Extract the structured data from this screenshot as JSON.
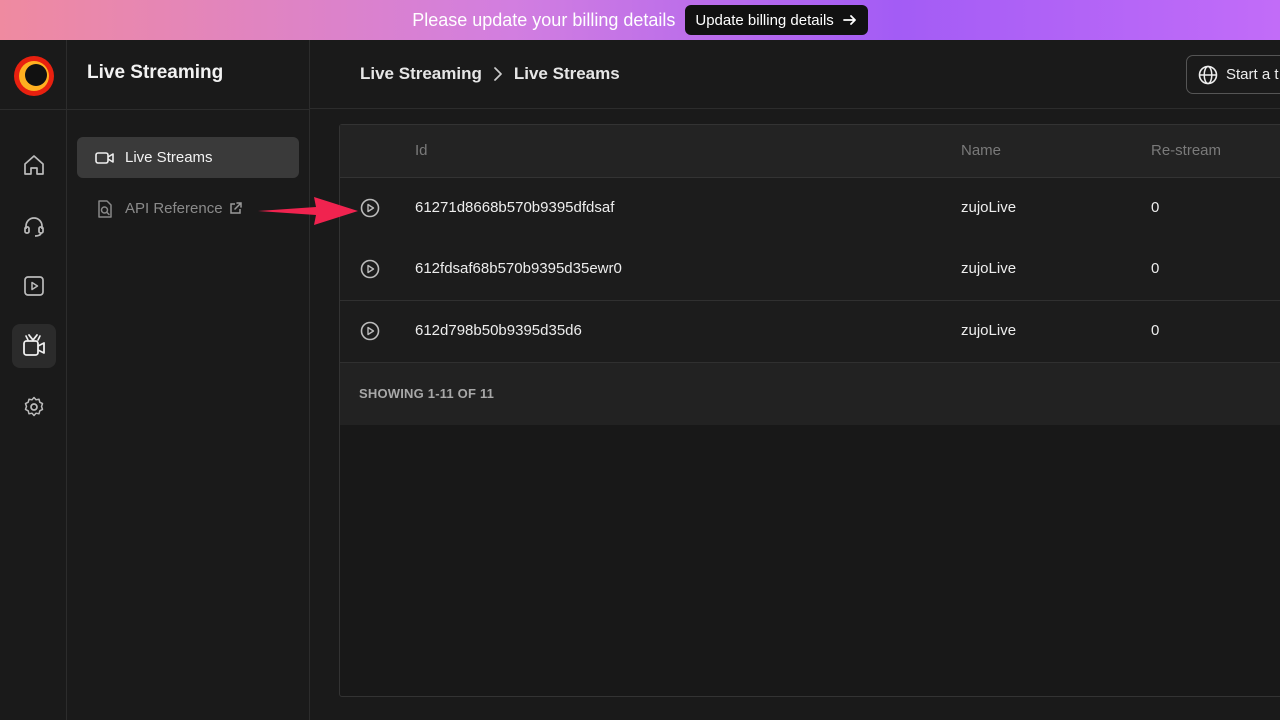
{
  "banner": {
    "message": "Please update your billing details",
    "button_label": "Update billing details"
  },
  "app": {
    "title": "Live Streaming"
  },
  "rail": {
    "items": [
      {
        "icon": "home-icon"
      },
      {
        "icon": "headset-icon"
      },
      {
        "icon": "video-play-icon"
      },
      {
        "icon": "tv-live-icon",
        "active": true
      },
      {
        "icon": "gear-icon"
      }
    ]
  },
  "sidebar": {
    "items": [
      {
        "label": "Live Streams",
        "icon": "video-camera-icon",
        "active": true
      },
      {
        "label": "API Reference",
        "icon": "api-doc-icon",
        "external": true
      }
    ]
  },
  "header": {
    "breadcrumb": [
      "Live Streaming",
      "Live Streams"
    ],
    "start_button_label": "Start a t"
  },
  "table": {
    "columns": [
      "Id",
      "Name",
      "Re-stream"
    ],
    "rows": [
      {
        "id": "61271d8668b570b9395dfdsaf",
        "name": "zujoLive",
        "restream": "0"
      },
      {
        "id": "612fdsaf68b570b9395d35ewr0",
        "name": "zujoLive",
        "restream": "0"
      },
      {
        "id": "612d798b50b9395d35d6",
        "name": "zujoLive",
        "restream": "0"
      }
    ],
    "footer": "SHOWING 1-11 OF 11"
  },
  "colors": {
    "annotation_arrow": "#f0234f",
    "banner_gradient_start": "#ef8aa0",
    "banner_gradient_end": "#a35cf5"
  }
}
